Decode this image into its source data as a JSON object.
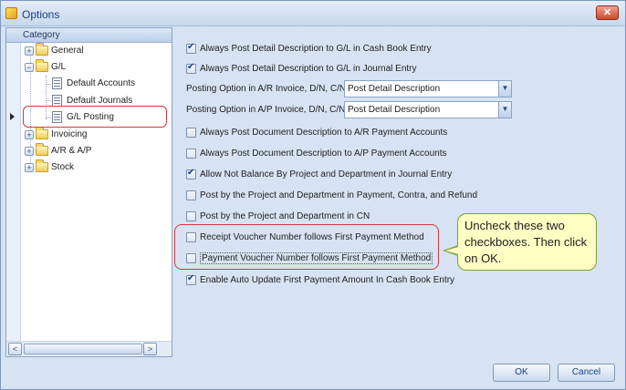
{
  "window": {
    "title": "Options",
    "close_symbol": "✕"
  },
  "category": {
    "header": "Category",
    "tree": [
      {
        "label": "General",
        "icon": "folder-icon",
        "expander": "+"
      },
      {
        "label": "G/L",
        "icon": "folder-icon",
        "expander": "−"
      },
      {
        "label": "Default Accounts",
        "icon": "document-icon"
      },
      {
        "label": "Default Journals",
        "icon": "document-icon"
      },
      {
        "label": "G/L Posting",
        "icon": "document-icon",
        "selected": true
      },
      {
        "label": "Invoicing",
        "icon": "folder-icon",
        "expander": "+"
      },
      {
        "label": "A/R & A/P",
        "icon": "folder-icon",
        "expander": "+"
      },
      {
        "label": "Stock",
        "icon": "folder-icon",
        "expander": "+"
      }
    ],
    "scroll_left": "<",
    "scroll_right": ">"
  },
  "options": [
    {
      "label": "Always Post Detail Description to G/L in Cash Book Entry",
      "checked": true
    },
    {
      "label": "Always Post Detail Description to G/L in Journal Entry",
      "checked": true
    },
    {
      "label": "Always Post Document Description to A/R Payment Accounts",
      "checked": false
    },
    {
      "label": "Always Post Document Description to A/P Payment Accounts",
      "checked": false
    },
    {
      "label": "Allow Not Balance By Project and Department in Journal Entry",
      "checked": true
    },
    {
      "label": "Post by the Project and Department in Payment, Contra, and Refund",
      "checked": false
    },
    {
      "label": "Post by the Project and Department in CN",
      "checked": false
    },
    {
      "label": "Receipt Voucher Number follows First Payment Method",
      "checked": false
    },
    {
      "label": "Payment Voucher Number follows First Payment Method",
      "checked": false
    },
    {
      "label": "Enable Auto Update First Payment Amount In Cash Book Entry",
      "checked": true
    }
  ],
  "combos": [
    {
      "label": "Posting Option in A/R Invoice, D/N, C/N",
      "value": "Post Detail Description"
    },
    {
      "label": "Posting Option in A/P Invoice, D/N, C/N",
      "value": "Post Detail Description"
    }
  ],
  "callout": {
    "text": "Uncheck these two checkboxes. Then click  on OK."
  },
  "buttons": {
    "ok": "OK",
    "cancel": "Cancel"
  },
  "colors": {
    "highlight": "#d23a3a",
    "callout_bg": "#ffffc4",
    "callout_border": "#7aa23a",
    "accent": "#15428b"
  }
}
